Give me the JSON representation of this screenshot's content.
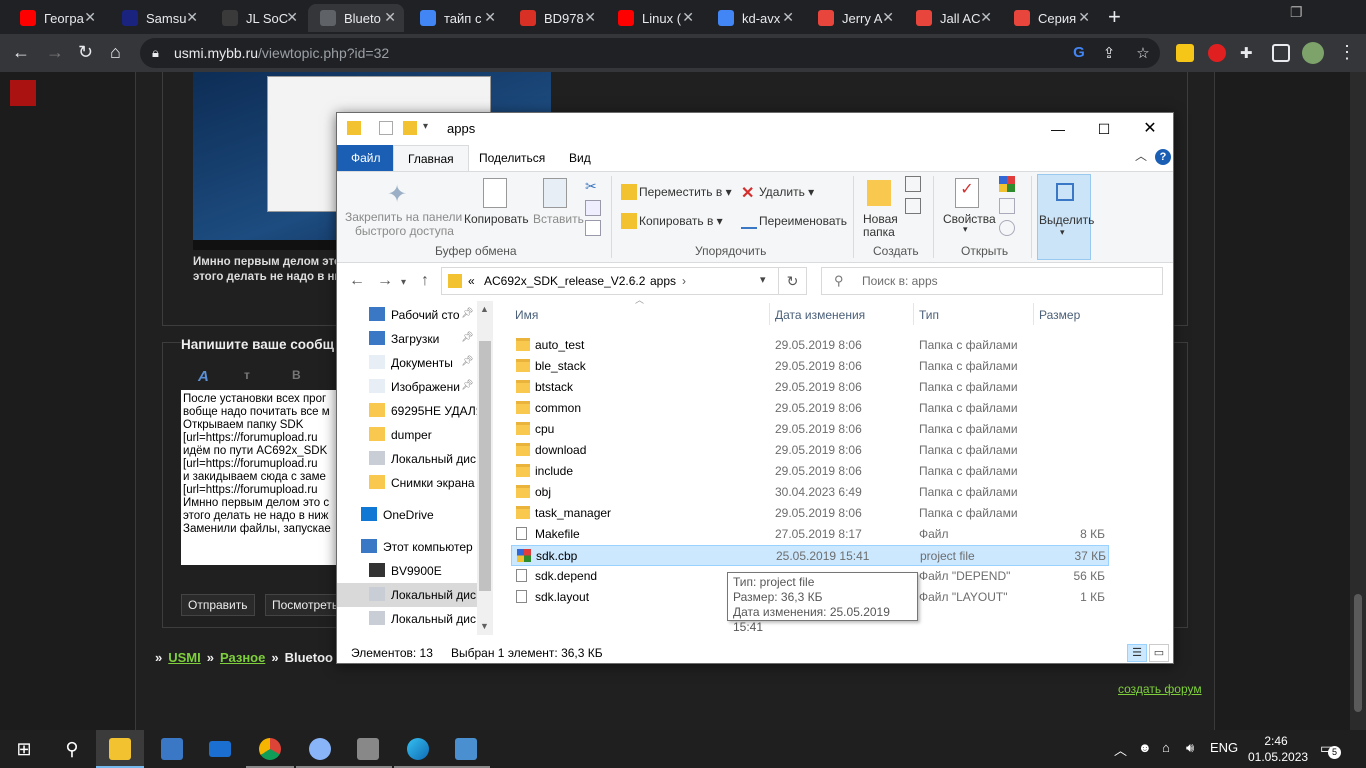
{
  "browser": {
    "tabs": [
      {
        "title": "Геогра",
        "favicon": "youtube-icon",
        "color": "#ff0000"
      },
      {
        "title": "Samsu",
        "favicon": "site-icon",
        "color": "#1a237e"
      },
      {
        "title": "JL SoC",
        "favicon": "jl-icon",
        "color": "#3a3a3a"
      },
      {
        "title": "Blueto",
        "favicon": "site-icon",
        "color": "#5f6368",
        "active": true
      },
      {
        "title": "тайп с",
        "favicon": "google-icon",
        "color": "#4285f4"
      },
      {
        "title": "BD978",
        "favicon": "pdf-icon",
        "color": "#d93025"
      },
      {
        "title": "Linux (",
        "favicon": "youtube-icon",
        "color": "#ff0000"
      },
      {
        "title": "kd-avx",
        "favicon": "google-icon",
        "color": "#4285f4"
      },
      {
        "title": "Jerry A",
        "favicon": "c-icon",
        "color": "#e8453c"
      },
      {
        "title": "Jall AC",
        "favicon": "c-icon",
        "color": "#e8453c"
      },
      {
        "title": "Серия",
        "favicon": "c-icon",
        "color": "#e8453c"
      }
    ],
    "url_host": "usmi.mybb.ru",
    "url_path": "/viewtopic.php?id=32"
  },
  "forum": {
    "post_text_1": "Имнно первым делом это",
    "post_text_2": "этого делать не надо в ни",
    "reply_title": "Напишите ваше сообщ",
    "format_buttons": [
      "A",
      "т",
      "B"
    ],
    "reply_lines": [
      "После установки всех прог",
      "вобще надо почитать все м",
      "Открываем папку SDK",
      "[url=https://forumupload.ru",
      "идём по пути AC692x_SDK",
      "[url=https://forumupload.ru",
      "и закидываем сюда с заме",
      "[url=https://forumupload.ru",
      "Имнно первым делом это с",
      "этого делать не надо в ниж",
      "Заменили файлы, запускае"
    ],
    "submit_label": "Отправить",
    "preview_label": "Посмотреть",
    "breadcrumb": [
      "USMI",
      "Разное",
      "Bluetoo"
    ],
    "create_forum": "создать форум"
  },
  "explorer": {
    "title": "apps",
    "ribbon_tabs": [
      "Файл",
      "Главная",
      "Поделиться",
      "Вид"
    ],
    "clipboard": {
      "pin_label_1": "Закрепить на панели",
      "pin_label_2": "быстрого доступа",
      "copy": "Копировать",
      "paste": "Вставить",
      "group": "Буфер обмена"
    },
    "organize": {
      "move_to": "Переместить в",
      "copy_to": "Копировать в",
      "delete": "Удалить",
      "rename": "Переименовать",
      "group": "Упорядочить"
    },
    "create": {
      "new_folder_1": "Новая",
      "new_folder_2": "папка",
      "group": "Создать"
    },
    "open": {
      "properties": "Свойства",
      "group": "Открыть"
    },
    "select": {
      "label": "Выделить"
    },
    "address": {
      "prefix": "«",
      "segments": [
        "AC692x_SDK_release_V2.6.2",
        "apps"
      ]
    },
    "search_placeholder": "Поиск в: apps",
    "nav_items": [
      {
        "label": "Рабочий сто",
        "icon": "desktop-icon",
        "pinned": true
      },
      {
        "label": "Загрузки",
        "icon": "download-icon",
        "pinned": true
      },
      {
        "label": "Документы",
        "icon": "documents-icon",
        "pinned": true
      },
      {
        "label": "Изображени",
        "icon": "pictures-icon",
        "pinned": true
      },
      {
        "label": "69295НЕ УДАЛЯ",
        "icon": "folder-icon",
        "pinned": false
      },
      {
        "label": "dumper",
        "icon": "folder-icon",
        "pinned": false
      },
      {
        "label": "Локальный дис",
        "icon": "drive-icon",
        "pinned": false
      },
      {
        "label": "Снимки экрана",
        "icon": "folder-icon",
        "pinned": false
      },
      {
        "label": "OneDrive",
        "icon": "onedrive-icon",
        "pinned": false
      },
      {
        "label": "Этот компьютер",
        "icon": "computer-icon",
        "pinned": false
      },
      {
        "label": "BV9900E",
        "icon": "phone-icon",
        "pinned": false
      },
      {
        "label": "Локальный дис",
        "icon": "drive-icon",
        "pinned": false,
        "selected": true
      },
      {
        "label": "Локальный дис",
        "icon": "drive-icon",
        "pinned": false
      }
    ],
    "columns": [
      "Имя",
      "Дата изменения",
      "Тип",
      "Размер"
    ],
    "files": [
      {
        "name": "auto_test",
        "date": "29.05.2019 8:06",
        "type": "Папка с файлами",
        "size": "",
        "kind": "folder"
      },
      {
        "name": "ble_stack",
        "date": "29.05.2019 8:06",
        "type": "Папка с файлами",
        "size": "",
        "kind": "folder"
      },
      {
        "name": "btstack",
        "date": "29.05.2019 8:06",
        "type": "Папка с файлами",
        "size": "",
        "kind": "folder"
      },
      {
        "name": "common",
        "date": "29.05.2019 8:06",
        "type": "Папка с файлами",
        "size": "",
        "kind": "folder"
      },
      {
        "name": "cpu",
        "date": "29.05.2019 8:06",
        "type": "Папка с файлами",
        "size": "",
        "kind": "folder"
      },
      {
        "name": "download",
        "date": "29.05.2019 8:06",
        "type": "Папка с файлами",
        "size": "",
        "kind": "folder"
      },
      {
        "name": "include",
        "date": "29.05.2019 8:06",
        "type": "Папка с файлами",
        "size": "",
        "kind": "folder"
      },
      {
        "name": "obj",
        "date": "30.04.2023 6:49",
        "type": "Папка с файлами",
        "size": "",
        "kind": "folder"
      },
      {
        "name": "task_manager",
        "date": "29.05.2019 8:06",
        "type": "Папка с файлами",
        "size": "",
        "kind": "folder"
      },
      {
        "name": "Makefile",
        "date": "27.05.2019 8:17",
        "type": "Файл",
        "size": "8 КБ",
        "kind": "doc"
      },
      {
        "name": "sdk.cbp",
        "date": "25.05.2019 15:41",
        "type": "project file",
        "size": "37 КБ",
        "kind": "cbp",
        "selected": true
      },
      {
        "name": "sdk.depend",
        "date": "",
        "type": "Файл \"DEPEND\"",
        "size": "56 КБ",
        "kind": "doc"
      },
      {
        "name": "sdk.layout",
        "date": "",
        "type": "Файл \"LAYOUT\"",
        "size": "1 КБ",
        "kind": "doc"
      }
    ],
    "tooltip": {
      "type": "Тип: project file",
      "size": "Размер: 36,3 КБ",
      "date": "Дата изменения: 25.05.2019 15:41"
    },
    "status": {
      "count": "Элементов: 13",
      "selected": "Выбран 1 элемент: 36,3 КБ"
    }
  },
  "taskbar": {
    "lang": "ENG",
    "time": "2:46",
    "date": "01.05.2023",
    "notifications": "5"
  }
}
